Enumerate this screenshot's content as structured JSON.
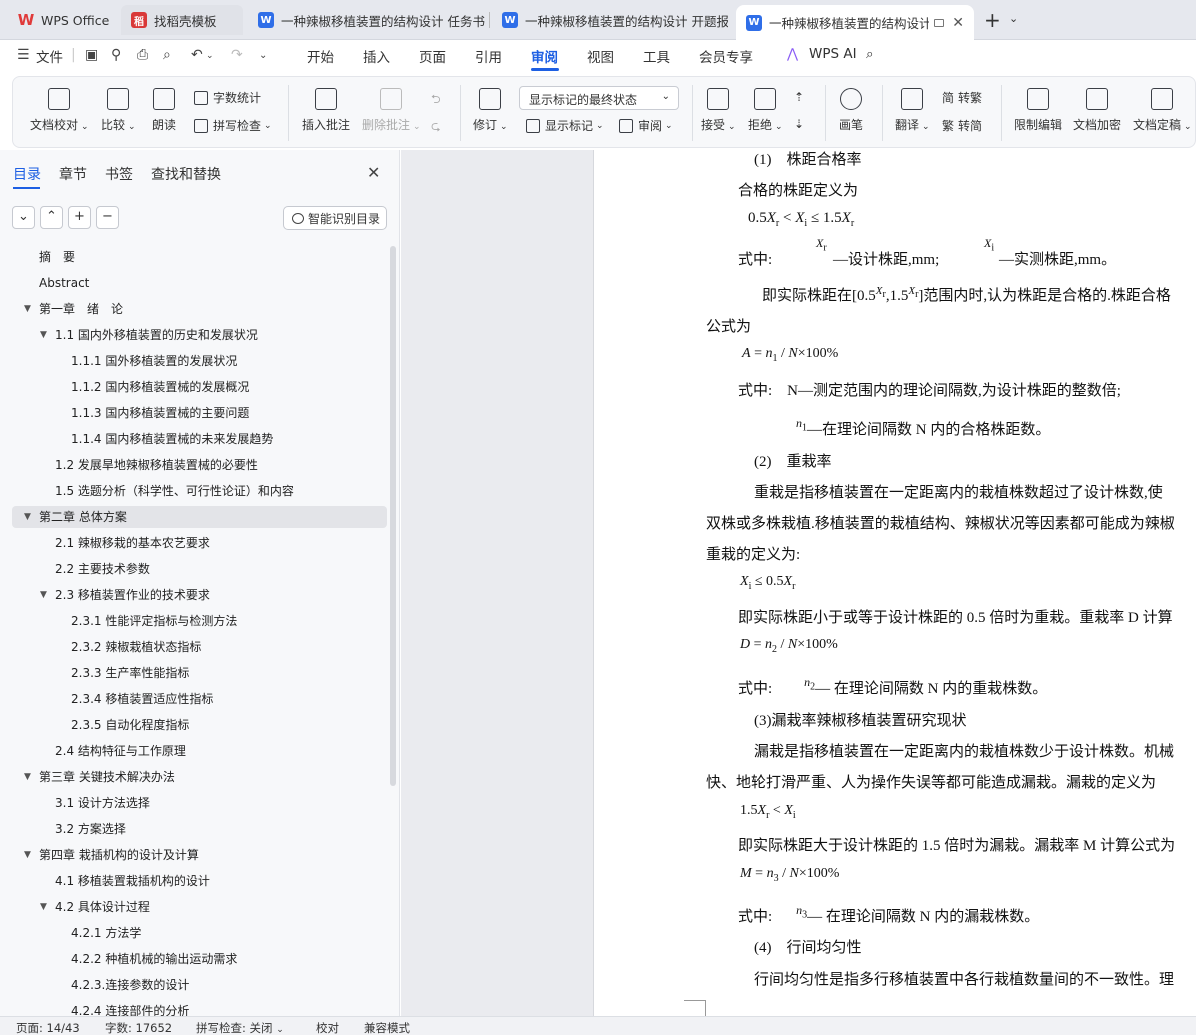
{
  "tabs": [
    {
      "label": "WPS Office",
      "icon": "wps-logo-icon"
    },
    {
      "label": "找稻壳模板",
      "icon": "docer-icon"
    },
    {
      "label": "一种辣椒移植装置的结构设计 任务书",
      "icon": "word-doc-icon"
    },
    {
      "label": "一种辣椒移植装置的结构设计 开题报告",
      "icon": "word-doc-icon"
    },
    {
      "label": "一种辣椒移植装置的结构设计",
      "icon": "word-doc-icon",
      "active": true
    }
  ],
  "menu": {
    "file": "文件",
    "items": [
      "开始",
      "插入",
      "页面",
      "引用",
      "审阅",
      "视图",
      "工具",
      "会员专享"
    ],
    "active": "审阅",
    "wps_ai": "WPS AI"
  },
  "ribbon": {
    "doc_proof": "文档校对",
    "compare": "比较",
    "read_aloud": "朗读",
    "word_count": "字数统计",
    "spell_check": "拼写检查",
    "insert_comment": "插入批注",
    "delete_comment": "删除批注",
    "track": "修订",
    "markup_state": "显示标记的最终状态",
    "show_markup": "显示标记",
    "review": "审阅",
    "accept": "接受",
    "reject": "拒绝",
    "pen": "画笔",
    "translate": "翻译",
    "to_traditional": "转繁",
    "to_simplified": "转简",
    "restrict_edit": "限制编辑",
    "encrypt": "文档加密",
    "finalize": "文档定稿"
  },
  "panel": {
    "tabs": [
      "目录",
      "章节",
      "书签",
      "查找和替换"
    ],
    "active_tab": "目录",
    "smart_button": "智能识别目录"
  },
  "toc": [
    {
      "text": "摘　要",
      "level": 0
    },
    {
      "text": "Abstract",
      "level": 0
    },
    {
      "text": "第一章　绪　论",
      "level": 0,
      "toggle": "open"
    },
    {
      "text": "1.1  国内外移植装置的历史和发展状况",
      "level": 1,
      "toggle": "open"
    },
    {
      "text": "1.1.1 国外移植装置的发展状况",
      "level": 2
    },
    {
      "text": "1.1.2 国内移植装置械的发展概况",
      "level": 2
    },
    {
      "text": "1.1.3    国内移植装置械的主要问题",
      "level": 2
    },
    {
      "text": "1.1.4  国内移植装置械的未来发展趋势",
      "level": 2
    },
    {
      "text": "1.2 发展旱地辣椒移植装置械的必要性",
      "level": 1
    },
    {
      "text": "1.5  选题分析（科学性、可行性论证）和内容",
      "level": 1
    },
    {
      "text": "第二章  总体方案",
      "level": 0,
      "toggle": "open",
      "selected": true
    },
    {
      "text": "2.1  辣椒移栽的基本农艺要求",
      "level": 1
    },
    {
      "text": "2.2  主要技术参数",
      "level": 1
    },
    {
      "text": "2.3 移植装置作业的技术要求",
      "level": 1,
      "toggle": "open"
    },
    {
      "text": "2.3.1  性能评定指标与检测方法",
      "level": 2
    },
    {
      "text": "2.3.2 辣椒栽植状态指标",
      "level": 2
    },
    {
      "text": "2.3.3  生产率性能指标",
      "level": 2
    },
    {
      "text": "2.3.4 移植装置适应性指标",
      "level": 2
    },
    {
      "text": "2.3.5 自动化程度指标",
      "level": 2
    },
    {
      "text": "2.4  结构特征与工作原理",
      "level": 1
    },
    {
      "text": "第三章  关键技术解决办法",
      "level": 0,
      "toggle": "open"
    },
    {
      "text": "3.1  设计方法选择",
      "level": 1
    },
    {
      "text": "3.2  方案选择",
      "level": 1
    },
    {
      "text": "第四章  栽插机构的设计及计算",
      "level": 0,
      "toggle": "open"
    },
    {
      "text": "4.1  移植装置栽插机构的设计",
      "level": 1
    },
    {
      "text": "4.2  具体设计过程",
      "level": 1,
      "toggle": "open"
    },
    {
      "text": "4.2.1  方法学",
      "level": 2
    },
    {
      "text": "4.2.2  种植机械的输出运动需求",
      "level": 2
    },
    {
      "text": "4.2.3.连接参数的设计",
      "level": 2
    },
    {
      "text": "4.2.4    连接部件的分析",
      "level": 2
    }
  ],
  "doc": {
    "h1": "(1)　株距合格率",
    "p1": "合格的株距定义为",
    "wherein": "式中:",
    "xr_desc": "—设计株距,mm;",
    "xi_desc": "—实测株距,mm。",
    "p2a": "即实际株距在[0.5",
    "p2b": ",1.5",
    "p2c": "]范围内时,认为株距是合格的.株距合格",
    "p3": "公式为",
    "where_N": "式中:　N—测定范围内的理论间隔数,为设计株距的整数倍;",
    "n1_desc": "—在理论间隔数 N 内的合格株距数。",
    "h2": "(2)　重栽率",
    "p4": "重栽是指移植装置在一定距离内的栽植株数超过了设计株数,使",
    "p5": "双株或多株栽植.移植装置的栽植结构、辣椒状况等因素都可能成为辣椒",
    "p6": "重栽的定义为:",
    "p7": "即实际株距小于或等于设计株距的 0.5 倍时为重栽。重栽率 D 计算",
    "n2_desc": "—  在理论间隔数 N 内的重栽株数。",
    "h3": "(3)漏栽率辣椒移植装置研究现状",
    "p8": "漏栽是指移植装置在一定距离内的栽植株数少于设计株数。机械",
    "p9": "快、地轮打滑严重、人为操作失误等都可能造成漏栽。漏栽的定义为",
    "p10": "即实际株距大于设计株距的 1.5 倍时为漏栽。漏栽率 M 计算公式为",
    "n3_desc": "—  在理论间隔数 N 内的漏栽株数。",
    "h4": "(4)　行间均匀性",
    "p11": "行间均匀性是指多行移植装置中各行栽植数量间的不一致性。理"
  },
  "status": {
    "page": "页面: 14/43",
    "words": "字数: 17652",
    "spell": "拼写检查: 关闭",
    "proof": "校对",
    "compat": "兼容模式"
  }
}
